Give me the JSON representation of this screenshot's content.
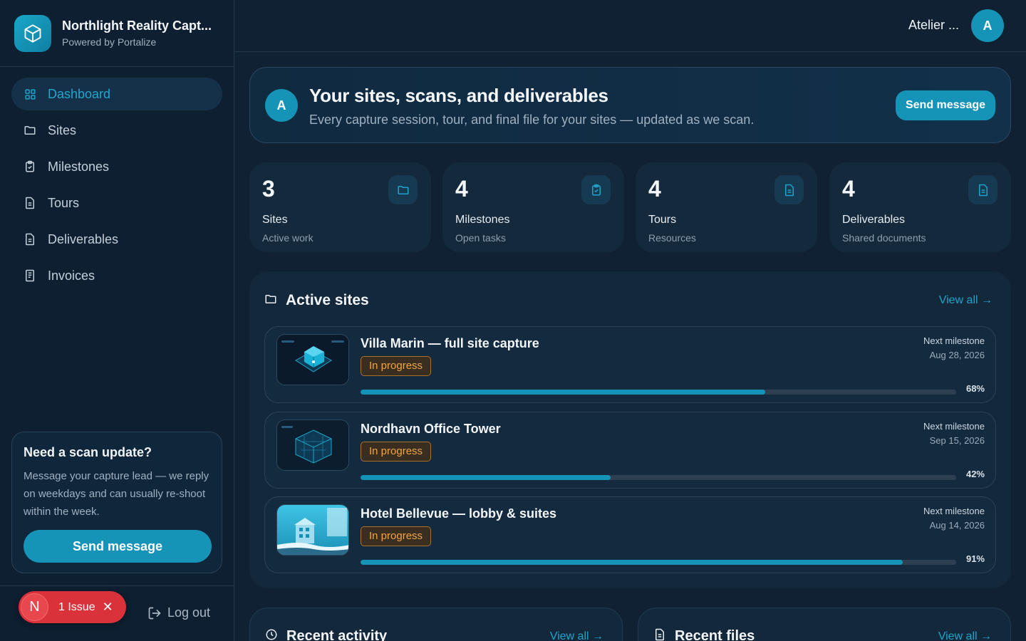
{
  "brand": {
    "title": "Northlight Reality Capt...",
    "subtitle": "Powered by Portalize"
  },
  "sidebar": {
    "items": [
      {
        "label": "Dashboard",
        "icon": "dashboard-icon",
        "active": true
      },
      {
        "label": "Sites",
        "icon": "folder-icon",
        "active": false
      },
      {
        "label": "Milestones",
        "icon": "clipboard-check-icon",
        "active": false
      },
      {
        "label": "Tours",
        "icon": "document-icon",
        "active": false
      },
      {
        "label": "Deliverables",
        "icon": "document-icon",
        "active": false
      },
      {
        "label": "Invoices",
        "icon": "receipt-icon",
        "active": false
      }
    ],
    "help": {
      "title": "Need a scan update?",
      "text": "Message your capture lead — we reply on weekdays and can usually re-shoot within the week.",
      "button": "Send message"
    },
    "issue": {
      "avatar": "N",
      "label": "1 Issue"
    },
    "logout": "Log out"
  },
  "topbar": {
    "user_name": "Atelier ...",
    "avatar": "A"
  },
  "hero": {
    "avatar": "A",
    "title": "Your sites, scans, and deliverables",
    "subtitle": "Every capture session, tour, and final file for your sites — updated as we scan.",
    "button": "Send message"
  },
  "stats": [
    {
      "value": "3",
      "label": "Sites",
      "sub": "Active work",
      "icon": "folder-icon"
    },
    {
      "value": "4",
      "label": "Milestones",
      "sub": "Open tasks",
      "icon": "clipboard-check-icon"
    },
    {
      "value": "4",
      "label": "Tours",
      "sub": "Resources",
      "icon": "document-icon"
    },
    {
      "value": "4",
      "label": "Deliverables",
      "sub": "Shared documents",
      "icon": "document-icon"
    }
  ],
  "active_sites": {
    "title": "Active sites",
    "view_all": "View all →",
    "sites": [
      {
        "name": "Villa Marin — full site capture",
        "status": "In progress",
        "milestone_label": "Next milestone",
        "milestone_date": "Aug 28, 2026",
        "progress": 68,
        "progress_text": "68%"
      },
      {
        "name": "Nordhavn Office Tower",
        "status": "In progress",
        "milestone_label": "Next milestone",
        "milestone_date": "Sep 15, 2026",
        "progress": 42,
        "progress_text": "42%"
      },
      {
        "name": "Hotel Bellevue — lobby & suites",
        "status": "In progress",
        "milestone_label": "Next milestone",
        "milestone_date": "Aug 14, 2026",
        "progress": 91,
        "progress_text": "91%"
      }
    ]
  },
  "recent_activity": {
    "title": "Recent activity",
    "view_all": "View all →"
  },
  "recent_files": {
    "title": "Recent files",
    "view_all": "View all →"
  },
  "colors": {
    "accent": "#1594b8",
    "accent_text": "#21a6cf",
    "status_in_progress": "#f0a445",
    "issue_red": "#d9323a",
    "background": "#0f2133"
  }
}
